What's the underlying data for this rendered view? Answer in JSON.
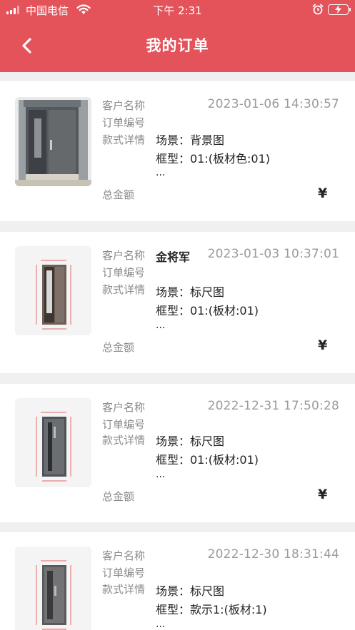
{
  "status_bar": {
    "carrier": "中国电信",
    "time": "下午 2:31"
  },
  "header": {
    "title": "我的订单",
    "back_icon": "chevron-left-icon"
  },
  "labels": {
    "customer": "客户名称",
    "order_no": "订单编号",
    "style_detail": "款式详情",
    "total": "总金额",
    "currency": "¥"
  },
  "orders": [
    {
      "customer_name": "",
      "datetime": "2023-01-06 14:30:57",
      "scene": "场景：背景图",
      "frame": "框型：01:(板材色:01)",
      "more": "...",
      "thumb": "door-photo"
    },
    {
      "customer_name": "金将军",
      "datetime": "2023-01-03 10:37:01",
      "scene": "场景：标尺图",
      "frame": "框型：01:(板材:01)",
      "more": "...",
      "thumb": "door-ruler-drawing"
    },
    {
      "customer_name": "",
      "datetime": "2022-12-31 17:50:28",
      "scene": "场景：标尺图",
      "frame": "框型：01:(板材:01)",
      "more": "...",
      "thumb": "door-ruler-drawing"
    },
    {
      "customer_name": "",
      "datetime": "2022-12-30 18:31:44",
      "scene": "场景：标尺图",
      "frame": "框型：款示1:(板材:1)",
      "more": "...",
      "thumb": "door-ruler-drawing"
    }
  ]
}
